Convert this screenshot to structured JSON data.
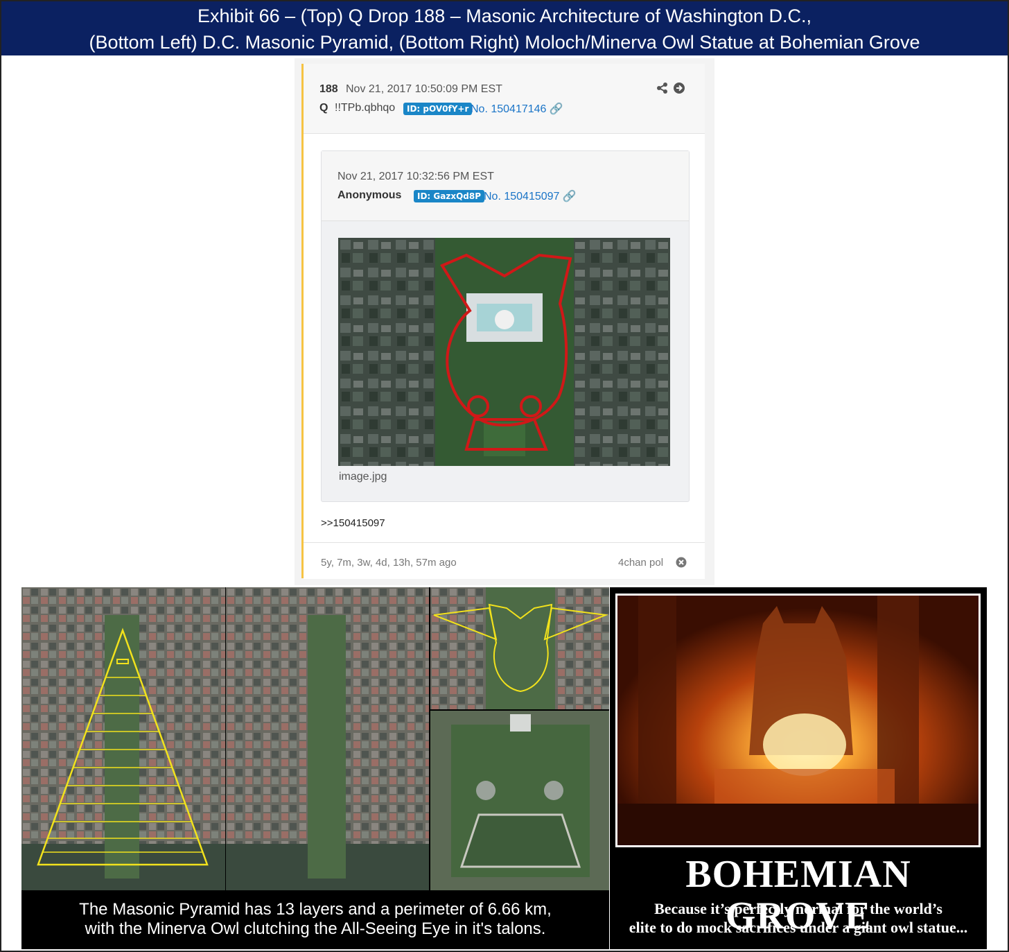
{
  "banner": {
    "line1": "Exhibit 66 – (Top) Q Drop 188 – Masonic Architecture of Washington D.C.,",
    "line2": "(Bottom Left) D.C. Masonic Pyramid, (Bottom Right) Moloch/Minerva Owl Statue at Bohemian Grove"
  },
  "post": {
    "number": "188",
    "date": "Nov 21, 2017 10:50:09 PM EST",
    "author": "Q",
    "tripcode": "!!TPb.qbhqo",
    "id_badge": "ID: pOV0fY+r",
    "post_no": "No. 150417146",
    "quoted": {
      "date": "Nov 21, 2017 10:32:56 PM EST",
      "author": "Anonymous",
      "id_badge": "ID: GazxQd8P",
      "post_no": "No. 150415097",
      "image_name": "image.jpg"
    },
    "body": ">>150415097",
    "age": "5y, 7m, 3w, 4d, 13h, 57m ago",
    "source": "4chan pol"
  },
  "bottom_left": {
    "caption_line1": "The Masonic Pyramid has 13 layers and a perimeter of 6.66 km,",
    "caption_line2": "with the Minerva Owl clutching the All-Seeing Eye in it's talons."
  },
  "bottom_right": {
    "title": "BOHEMIAN GROVE",
    "sub_line1": "Because it’s perfectly normal for the world’s",
    "sub_line2": "elite to do mock sacrifices under a giant owl statue..."
  },
  "colors": {
    "banner_bg": "#0b2161",
    "badge": "#1a86c7",
    "link": "#1a74c7",
    "post_accent": "#f6c343",
    "overlay_red": "#d01818",
    "overlay_yellow": "#f2e21c"
  }
}
